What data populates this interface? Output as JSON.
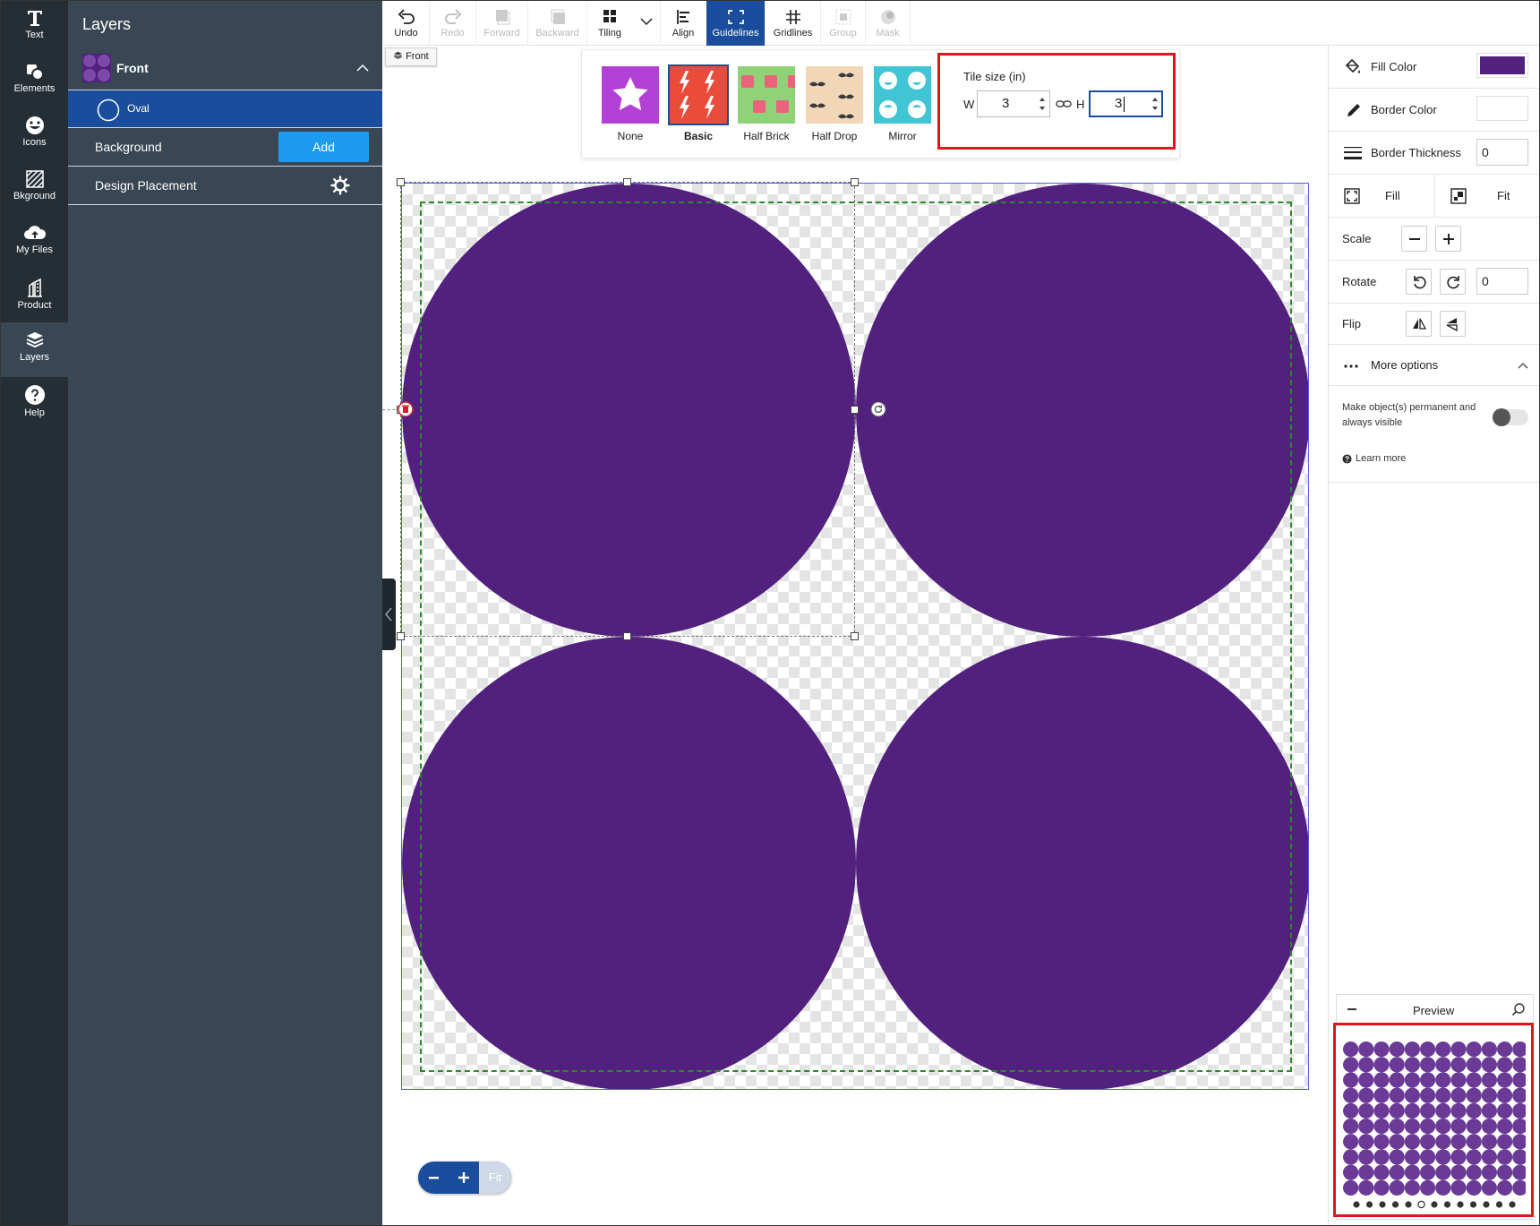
{
  "rail": {
    "items": [
      {
        "label": "Text",
        "icon": "text-icon"
      },
      {
        "label": "Elements",
        "icon": "elements-icon"
      },
      {
        "label": "Icons",
        "icon": "smiley-icon"
      },
      {
        "label": "Bkground",
        "icon": "background-icon"
      },
      {
        "label": "My Files",
        "icon": "cloud-upload-icon"
      },
      {
        "label": "Product",
        "icon": "product-icon"
      },
      {
        "label": "Layers",
        "icon": "layers-icon"
      },
      {
        "label": "Help",
        "icon": "help-icon"
      }
    ]
  },
  "layers": {
    "title": "Layers",
    "front_label": "Front",
    "oval_label": "Oval",
    "background_label": "Background",
    "add_label": "Add",
    "placement_label": "Design Placement"
  },
  "toolbar": {
    "undo": "Undo",
    "redo": "Redo",
    "forward": "Forward",
    "backward": "Backward",
    "tiling": "Tiling",
    "align": "Align",
    "guidelines": "Guidelines",
    "gridlines": "Gridlines",
    "group": "Group",
    "mask": "Mask"
  },
  "front_chip": "Front",
  "tiling": {
    "options": [
      {
        "label": "None",
        "selected": false
      },
      {
        "label": "Basic",
        "selected": true
      },
      {
        "label": "Half Brick",
        "selected": false
      },
      {
        "label": "Half Drop",
        "selected": false
      },
      {
        "label": "Mirror",
        "selected": false
      }
    ],
    "tile_size_label": "Tile size (in)",
    "w_label": "W",
    "w_value": "3",
    "h_label": "H",
    "h_value": "3"
  },
  "props": {
    "fill_color_label": "Fill Color",
    "fill_color": "#52217d",
    "border_color_label": "Border Color",
    "border_thickness_label": "Border Thickness",
    "border_thickness_value": "0",
    "fill_label": "Fill",
    "fit_label": "Fit",
    "scale_label": "Scale",
    "rotate_label": "Rotate",
    "rotate_value": "0",
    "flip_label": "Flip",
    "more_options_label": "More options",
    "permanent_label": "Make object(s) permanent and always visible",
    "learn_more_label": "Learn more"
  },
  "preview": {
    "title": "Preview",
    "page_dots_total": 13,
    "active_dot": 5
  },
  "zoom": {
    "fit_label": "Fit"
  },
  "colors": {
    "accent": "#1a4e9c",
    "add_button": "#1d9bf0",
    "shape_fill": "#52217d",
    "highlight": "#e2151b"
  }
}
